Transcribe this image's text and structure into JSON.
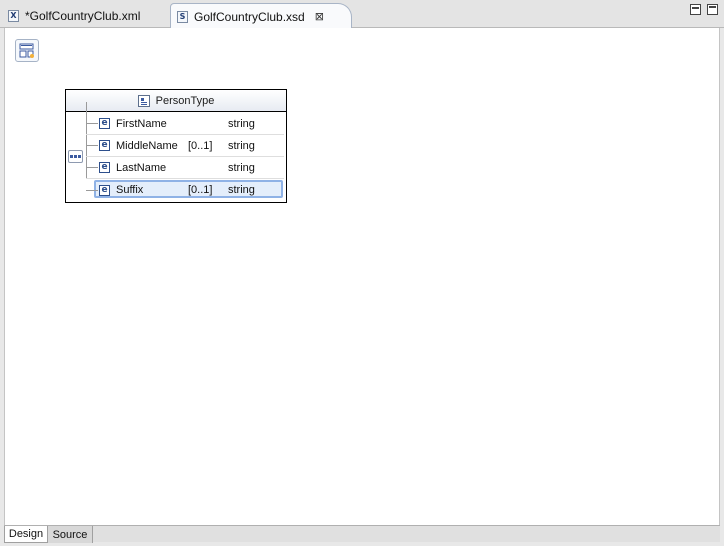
{
  "tabs": [
    {
      "label": "*GolfCountryClub.xml",
      "icon": "xml-file-icon",
      "active": false
    },
    {
      "label": "GolfCountryClub.xsd",
      "icon": "xsd-file-icon",
      "active": true
    }
  ],
  "tab_icons": {
    "xml": "X",
    "xsd": "S"
  },
  "complex_type": {
    "name": "PersonType",
    "elements": [
      {
        "icon": "e",
        "name": "FirstName",
        "occurrence": "",
        "type": "string"
      },
      {
        "icon": "e",
        "name": "MiddleName",
        "occurrence": "[0..1]",
        "type": "string"
      },
      {
        "icon": "e",
        "name": "LastName",
        "occurrence": "",
        "type": "string"
      },
      {
        "icon": "e",
        "name": "Suffix",
        "occurrence": "[0..1]",
        "type": "string",
        "selected": true
      }
    ]
  },
  "bottom_tabs": [
    {
      "label": "Design",
      "active": true
    },
    {
      "label": "Source",
      "active": false
    }
  ],
  "colors": {
    "selection_fill": "#e4eefb",
    "selection_border": "#8fb2e6",
    "element_icon": "#2d4f8c"
  }
}
